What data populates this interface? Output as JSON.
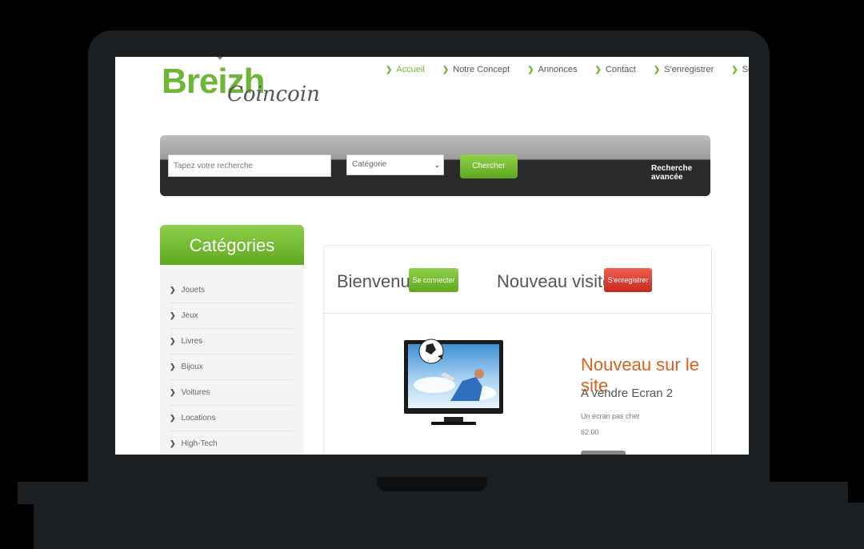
{
  "brand": {
    "part1": "Breizh",
    "part2": "Coincoin"
  },
  "nav": [
    {
      "label": "Accueil",
      "active": true
    },
    {
      "label": "Notre Concept",
      "active": false
    },
    {
      "label": "Annonces",
      "active": false
    },
    {
      "label": "Contact",
      "active": false
    },
    {
      "label": "S'enregistrer",
      "active": false
    },
    {
      "label": "Se Connecter",
      "active": false
    }
  ],
  "search": {
    "placeholder": "Tapez votre recherche",
    "category_selected": "Catégorie",
    "button_label": "Chercher",
    "advanced_label": "Recherche avancée"
  },
  "categories": {
    "title": "Catégories",
    "items": [
      "Jouets",
      "Jeux",
      "Livres",
      "Bijoux",
      "Voitures",
      "Locations",
      "High-Tech"
    ]
  },
  "welcome": {
    "greeting": "Bienvenue !",
    "login_label": "Se connecter",
    "new_visitor": "Nouveau visiteur ?",
    "register_label": "S'enregistrer"
  },
  "featured": {
    "section_title": "Nouveau sur le site",
    "product_name": "A vendre Ecran 2",
    "description": "Un écran pas cher",
    "price": "62.00"
  },
  "colors": {
    "accent_green": "#6fb536",
    "accent_orange": "#d9601c",
    "accent_red": "#d8382a"
  },
  "icons": {
    "nav_bullet": "chevron-right-icon",
    "category_bullet": "chevron-right-icon",
    "select_caret": "chevron-down-icon"
  }
}
